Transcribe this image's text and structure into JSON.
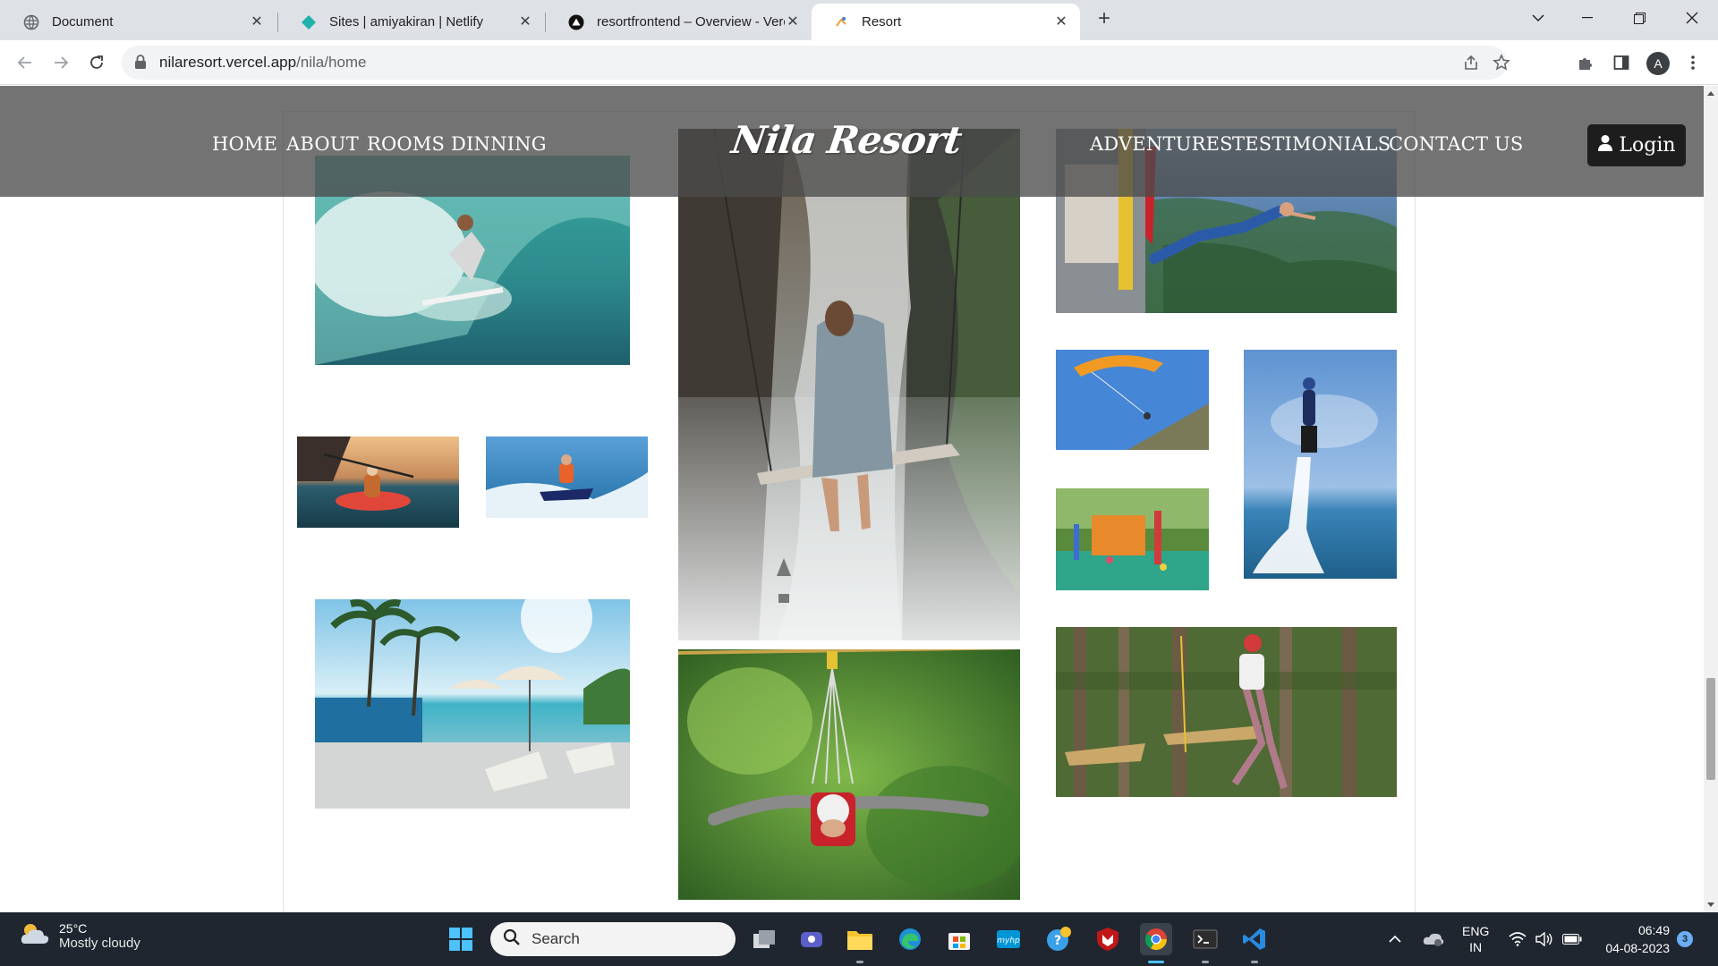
{
  "browser": {
    "tabs": [
      {
        "title": "Document",
        "favicon": "globe-icon",
        "active": false
      },
      {
        "title": "Sites | amiyakiran | Netlify",
        "favicon": "netlify-icon",
        "active": false
      },
      {
        "title": "resortfrontend – Overview - Vercel",
        "favicon": "vercel-icon",
        "active": false
      },
      {
        "title": "Resort",
        "favicon": "resort-favicon",
        "active": true
      }
    ],
    "url_host": "nilaresort.vercel.app",
    "url_path": "/nila/home",
    "profile_initial": "A"
  },
  "site": {
    "logo": "Nila Resort",
    "nav_left": [
      "HOME",
      "ABOUT",
      "ROOMS",
      "DINNING"
    ],
    "nav_right": [
      "ADVENTURES",
      "TESTIMONIALS",
      "CONTACT US"
    ],
    "login_label": "Login",
    "gallery": [
      {
        "name": "surfing-photo"
      },
      {
        "name": "waterfall-swing-photo"
      },
      {
        "name": "bungee-jump-photo"
      },
      {
        "name": "kayaking-photo"
      },
      {
        "name": "jet-ski-photo"
      },
      {
        "name": "paragliding-photo"
      },
      {
        "name": "flyboard-photo"
      },
      {
        "name": "playground-photo"
      },
      {
        "name": "beach-resort-photo"
      },
      {
        "name": "zipline-photo"
      },
      {
        "name": "ropes-course-photo"
      }
    ]
  },
  "taskbar": {
    "weather_temp": "25°C",
    "weather_desc": "Mostly cloudy",
    "search_placeholder": "Search",
    "lang_top": "ENG",
    "lang_bottom": "IN",
    "time": "06:49",
    "date": "04-08-2023",
    "notification_count": "3"
  },
  "colors": {
    "header_overlay": "#4b4b4b",
    "login_bg": "#1d1d1d",
    "taskbar_bg": "#1f2630",
    "tabstrip_bg": "#dee1e6"
  }
}
